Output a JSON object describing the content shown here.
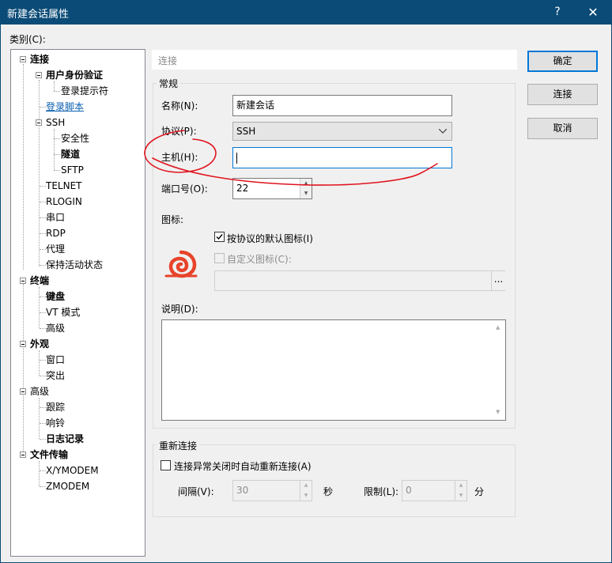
{
  "window": {
    "title": "新建会话属性",
    "help": "?",
    "close": "✕"
  },
  "tree": {
    "label": "类别(C):",
    "items": [
      {
        "label": "连接"
      },
      {
        "label": "用户身份验证"
      },
      {
        "label": "登录提示符"
      },
      {
        "label": "登录脚本"
      },
      {
        "label": "SSH"
      },
      {
        "label": "安全性"
      },
      {
        "label": "隧道"
      },
      {
        "label": "SFTP"
      },
      {
        "label": "TELNET"
      },
      {
        "label": "RLOGIN"
      },
      {
        "label": "串口"
      },
      {
        "label": "RDP"
      },
      {
        "label": "代理"
      },
      {
        "label": "保持活动状态"
      },
      {
        "label": "终端"
      },
      {
        "label": "键盘"
      },
      {
        "label": "VT 模式"
      },
      {
        "label": "高级"
      },
      {
        "label": "外观"
      },
      {
        "label": "窗口"
      },
      {
        "label": "突出"
      },
      {
        "label": "高级"
      },
      {
        "label": "跟踪"
      },
      {
        "label": "响铃"
      },
      {
        "label": "日志记录"
      },
      {
        "label": "文件传输"
      },
      {
        "label": "X/YMODEM"
      },
      {
        "label": "ZMODEM"
      }
    ]
  },
  "main": {
    "breadcrumb": "连接",
    "general": {
      "title": "常规",
      "name_label": "名称(N):",
      "name_value": "新建会话",
      "protocol_label": "协议(P):",
      "protocol_value": "SSH",
      "host_label": "主机(H):",
      "host_value": "",
      "port_label": "端口号(O):",
      "port_value": "22",
      "icon_label": "图标:",
      "default_icon_label": "按协议的默认图标(I)",
      "custom_icon_label": "自定义图标(C):",
      "custom_icon_path": "",
      "browse": "...",
      "description_label": "说明(D):",
      "description_value": ""
    },
    "reconnect": {
      "title": "重新连接",
      "auto_reconnect_label": "连接异常关闭时自动重新连接(A)",
      "interval_label": "间隔(V):",
      "interval_value": "30",
      "interval_unit": "秒",
      "limit_label": "限制(L):",
      "limit_value": "0",
      "limit_unit": "分"
    }
  },
  "buttons": {
    "ok": "确定",
    "connect": "连接",
    "cancel": "取消"
  },
  "colors": {
    "titlebar": "#0b4b77",
    "annotation": "#e0141e",
    "icon": "#e8432a"
  }
}
